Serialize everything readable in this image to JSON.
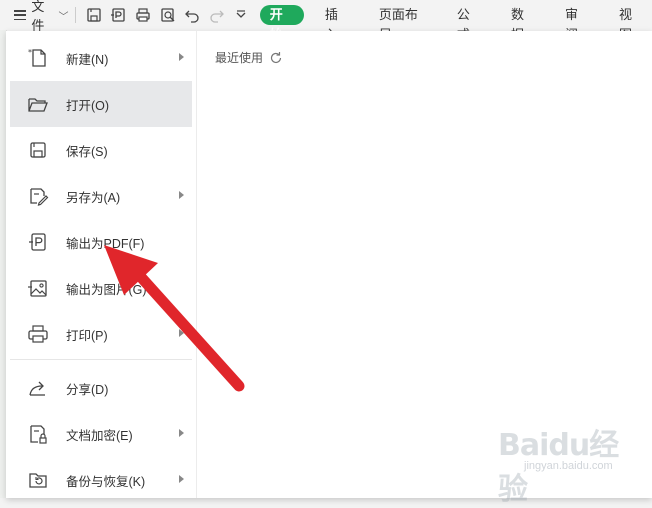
{
  "toolbar": {
    "menu_label": "文件",
    "tabs": [
      "开始",
      "插入",
      "页面布局",
      "公式",
      "数据",
      "审阅",
      "视图"
    ],
    "icons": [
      "save-icon",
      "export-pdf-icon",
      "print-icon",
      "print-preview-icon",
      "undo-icon",
      "redo-icon",
      "more-dropdown-icon"
    ]
  },
  "file_menu": {
    "items": [
      {
        "label": "新建(N)",
        "icon": "new-doc-icon",
        "submenu": true
      },
      {
        "label": "打开(O)",
        "icon": "folder-open-icon",
        "submenu": false,
        "highlighted": true
      },
      {
        "label": "保存(S)",
        "icon": "save-icon",
        "submenu": false
      },
      {
        "label": "另存为(A)",
        "icon": "save-as-icon",
        "submenu": true
      },
      {
        "label": "输出为PDF(F)",
        "icon": "export-pdf-icon",
        "submenu": false
      },
      {
        "label": "输出为图片(G)",
        "icon": "export-image-icon",
        "submenu": false
      },
      {
        "label": "打印(P)",
        "icon": "print-icon",
        "submenu": true
      },
      {
        "label": "分享(D)",
        "icon": "share-icon",
        "submenu": false
      },
      {
        "label": "文档加密(E)",
        "icon": "encrypt-doc-icon",
        "submenu": true
      },
      {
        "label": "备份与恢复(K)",
        "icon": "backup-restore-icon",
        "submenu": true
      }
    ]
  },
  "recent": {
    "title": "最近使用"
  },
  "watermark": {
    "text": "Baidu经验",
    "sub": "jingyan.baidu.com"
  },
  "colors": {
    "accent": "#1fa95c",
    "annotation_arrow": "#e0262b"
  }
}
